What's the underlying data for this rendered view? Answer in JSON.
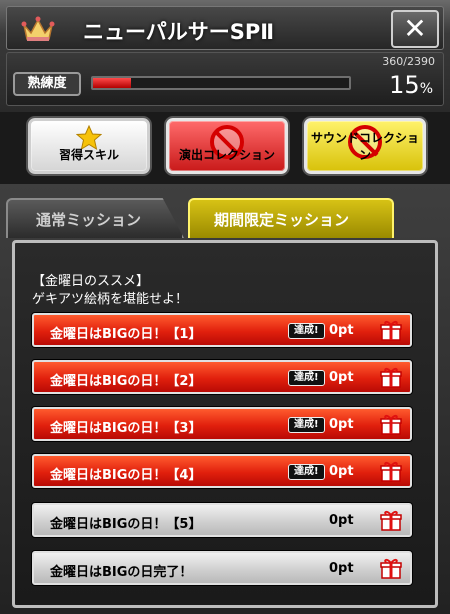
{
  "header": {
    "title": "ニューパルサーSPⅡ",
    "close_symbol": "✕",
    "proficiency_label": "熟練度",
    "proficiency_count": "360/2390",
    "proficiency_percent": "15",
    "proficiency_unit": "%",
    "proficiency_fraction": 0.15
  },
  "buttons": {
    "skill_label": "習得スキル",
    "effect_label": "演出コレクション",
    "sound_label": "サウンドコレクション"
  },
  "tabs": {
    "normal_label": "通常ミッション",
    "limited_label": "期間限定ミッション"
  },
  "mission": {
    "desc_line1": "【金曜日のススメ】",
    "desc_line2": "ゲキアツ絵柄を堪能せよ！",
    "rows": [
      {
        "label": "金曜日はBIGの日！【1】",
        "badge": "達成!",
        "points": "0pt",
        "status": "achieved"
      },
      {
        "label": "金曜日はBIGの日！【2】",
        "badge": "達成!",
        "points": "0pt",
        "status": "achieved"
      },
      {
        "label": "金曜日はBIGの日！【3】",
        "badge": "達成!",
        "points": "0pt",
        "status": "achieved"
      },
      {
        "label": "金曜日はBIGの日！【4】",
        "badge": "達成!",
        "points": "0pt",
        "status": "achieved"
      },
      {
        "label": "金曜日はBIGの日！【5】",
        "badge": "",
        "points": "0pt",
        "status": "pending"
      },
      {
        "label": "金曜日はBIGの日完了！",
        "badge": "",
        "points": "0pt",
        "status": "pending"
      }
    ]
  },
  "colors": {
    "accent_red": "#e1200d",
    "accent_yellow": "#d7c215",
    "progress_red": "#ff4a4a"
  }
}
